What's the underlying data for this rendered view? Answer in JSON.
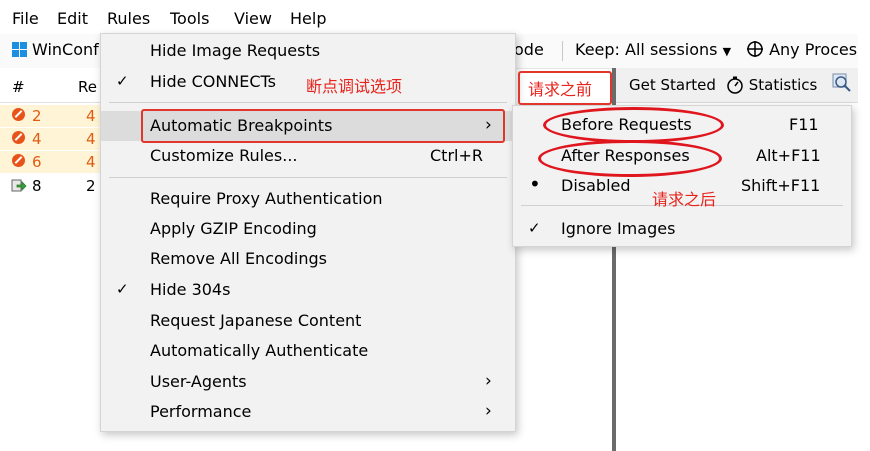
{
  "menubar": {
    "items": [
      "File",
      "Edit",
      "Rules",
      "Tools",
      "View",
      "Help"
    ]
  },
  "toolbar": {
    "winconfig": "WinConf",
    "mode_tail": "ode",
    "keep": "Keep: All sessions",
    "process": "Any Proces"
  },
  "sessions": {
    "header_num": "#",
    "header_result": "Re",
    "rows": [
      {
        "num": "2",
        "res": "4"
      },
      {
        "num": "4",
        "res": "4"
      },
      {
        "num": "6",
        "res": "4"
      },
      {
        "num": "8",
        "res": "2"
      }
    ]
  },
  "tabs": {
    "get_started": "Get Started",
    "statistics": "Statistics"
  },
  "rules_menu": {
    "hide_image_requests": "Hide Image Requests",
    "hide_connects": "Hide CONNECTs",
    "automatic_breakpoints": "Automatic Breakpoints",
    "customize_rules": "Customize Rules...",
    "customize_shortcut": "Ctrl+R",
    "require_proxy_auth": "Require Proxy Authentication",
    "apply_gzip": "Apply GZIP Encoding",
    "remove_encodings": "Remove All Encodings",
    "hide_304s": "Hide 304s",
    "request_japanese": "Request Japanese Content",
    "auto_authenticate": "Automatically Authenticate",
    "user_agents": "User-Agents",
    "performance": "Performance"
  },
  "breakpoints_menu": {
    "before_requests": "Before Requests",
    "before_shortcut": "F11",
    "after_responses": "After Responses",
    "after_shortcut": "Alt+F11",
    "disabled": "Disabled",
    "disabled_shortcut": "Shift+F11",
    "ignore_images": "Ignore Images"
  },
  "annotations": {
    "breakpoint_options": "断点调试选项",
    "before_request": "请求之前",
    "after_request": "请求之后"
  },
  "colors": {
    "annotation_red": "#e8231c",
    "error_orange": "#e05a10"
  }
}
